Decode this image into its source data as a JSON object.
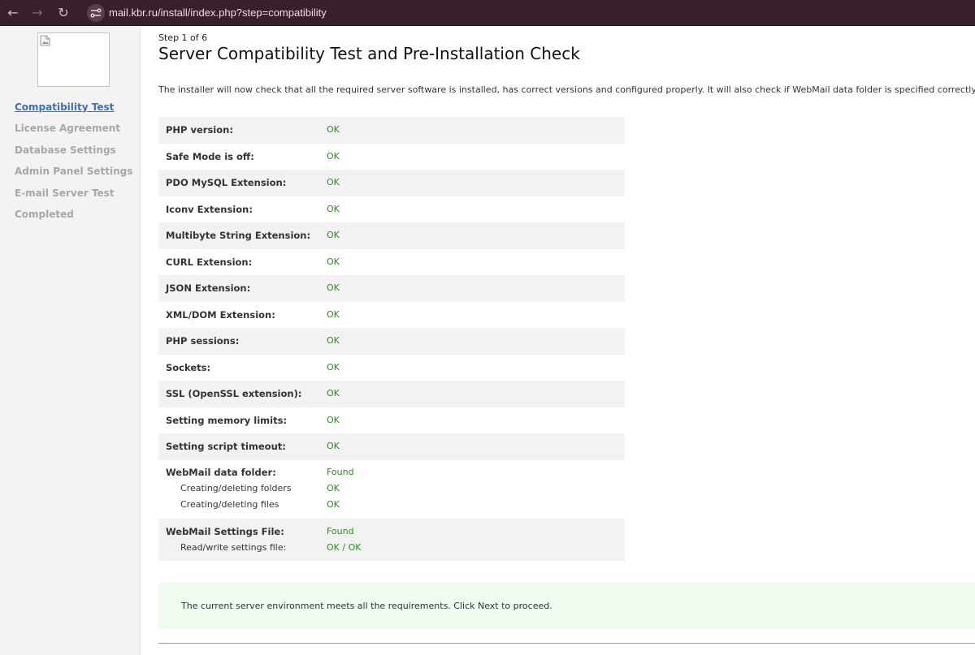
{
  "browser": {
    "url": "mail.kbr.ru/install/index.php?step=compatibility",
    "back_icon": "←",
    "forward_icon": "→",
    "reload_icon": "↻"
  },
  "sidebar": {
    "steps": [
      {
        "label": "Compatibility Test",
        "active": true
      },
      {
        "label": "License Agreement"
      },
      {
        "label": "Database Settings"
      },
      {
        "label": "Admin Panel Settings"
      },
      {
        "label": "E-mail Server Test"
      },
      {
        "label": "Completed"
      }
    ]
  },
  "header": {
    "step": "Step 1 of 6",
    "title": "Server Compatibility Test and Pre-Installation Check",
    "intro": "The installer will now check that all the required server software is installed, has correct versions and configured properly. It will also check if WebMail data folder is specified correctly."
  },
  "checks": [
    {
      "label": "PHP version:",
      "value": "OK"
    },
    {
      "label": "Safe Mode is off:",
      "value": "OK"
    },
    {
      "label": "PDO MySQL Extension:",
      "value": "OK"
    },
    {
      "label": "Iconv Extension:",
      "value": "OK"
    },
    {
      "label": "Multibyte String Extension:",
      "value": "OK"
    },
    {
      "label": "CURL Extension:",
      "value": "OK"
    },
    {
      "label": "JSON Extension:",
      "value": "OK"
    },
    {
      "label": "XML/DOM Extension:",
      "value": "OK"
    },
    {
      "label": "PHP sessions:",
      "value": "OK"
    },
    {
      "label": "Sockets:",
      "value": "OK"
    },
    {
      "label": "SSL (OpenSSL extension):",
      "value": "OK"
    },
    {
      "label": "Setting memory limits:",
      "value": "OK"
    },
    {
      "label": "Setting script timeout:",
      "value": "OK"
    }
  ],
  "data_folder": {
    "label": "WebMail data folder:",
    "value": "Found",
    "sub": [
      {
        "label": "Creating/deleting folders",
        "value": "OK"
      },
      {
        "label": "Creating/deleting files",
        "value": "OK"
      }
    ]
  },
  "settings_file": {
    "label": "WebMail Settings File:",
    "value": "Found",
    "sub": [
      {
        "label": "Read/write settings file:",
        "value": "OK / OK"
      }
    ]
  },
  "result": {
    "message": "The current server environment meets all the requirements. Click Next to proceed."
  },
  "colors": {
    "ok": "#2e8b1e",
    "active_link": "#3b6fc0",
    "toolbar": "#3a1e2c",
    "success_bg": "#effbee"
  }
}
